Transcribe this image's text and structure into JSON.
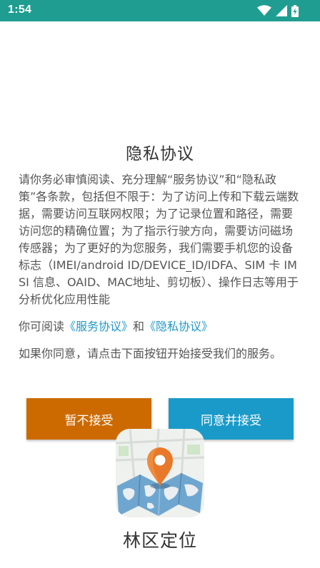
{
  "status_bar": {
    "time": "1:54",
    "color": "#1f9d91",
    "icons": [
      "wifi-icon",
      "signal-icon",
      "battery-charging-icon"
    ]
  },
  "dialog": {
    "title": "隐私协议",
    "paragraph1": "请你务必审慎阅读、充分理解“服务协议”和“隐私政策”各条款，包括但不限于：为了访问上传和下载云端数据，需要访问互联网权限；为了记录位置和路径，需要访问您的精确位置；为了指示行驶方向，需要访问磁场传感器；为了更好的为您服务，我们需要手机您的设备标志（IMEI/android ID/DEVICE_ID/IDFA、SIM 卡 IMSI 信息、OAID、MAC地址、剪切板）、操作日志等用于分析优化应用性能",
    "paragraph2_prefix": "你可阅读",
    "service_link": "《服务协议》",
    "paragraph2_mid": "和",
    "privacy_link": "《隐私协议》",
    "paragraph3": "如果你同意，请点击下面按钮开始接受我们的服务。",
    "reject_label": "暂不接受",
    "accept_label": "同意并接受",
    "reject_color": "#cc6a00",
    "accept_color": "#1a9ac9",
    "link_color": "#2196c8"
  },
  "app": {
    "icon": "map-pin-icon",
    "name": "林区定位"
  }
}
